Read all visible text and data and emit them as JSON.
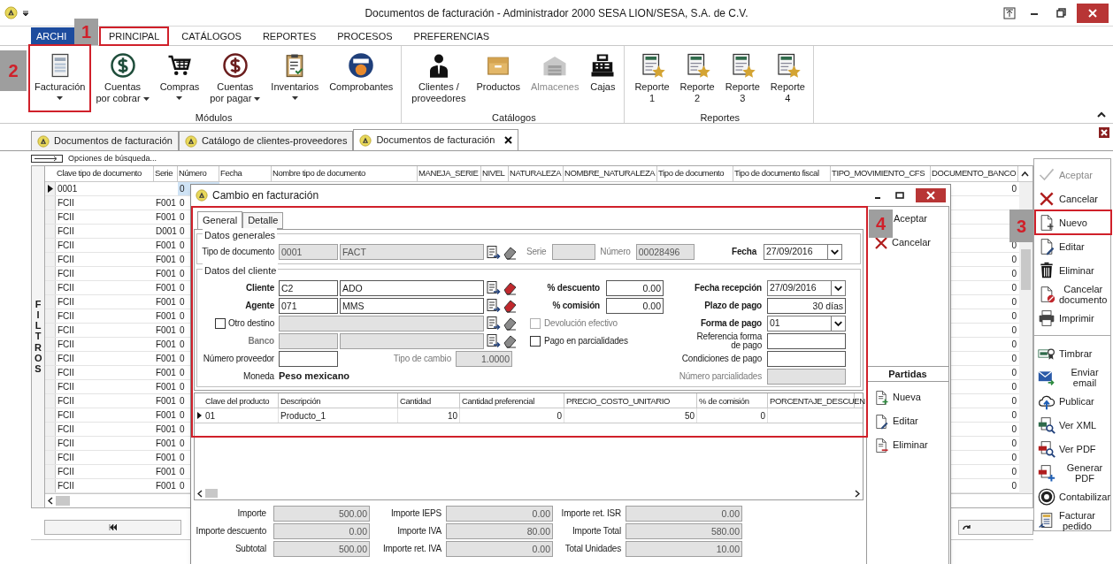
{
  "window": {
    "title": "Documentos de facturación - Administrador 2000 SESA LION/SESA, S.A. de C.V."
  },
  "menu_tabs": [
    {
      "label": "ARCHI",
      "kind": "file",
      "selected": false
    },
    {
      "label": "PRINCIPAL",
      "kind": "tab",
      "selected": true,
      "callout": "1"
    },
    {
      "label": "CATÁLOGOS",
      "kind": "tab",
      "selected": false
    },
    {
      "label": "REPORTES",
      "kind": "tab",
      "selected": false
    },
    {
      "label": "PROCESOS",
      "kind": "tab",
      "selected": false
    },
    {
      "label": "PREFERENCIAS",
      "kind": "tab",
      "selected": false
    }
  ],
  "ribbon_groups": [
    {
      "label": "Módulos",
      "buttons": [
        {
          "label": "Facturación",
          "kind": "invoice",
          "dropdown": true,
          "disabled": false,
          "callout": "2"
        },
        {
          "label": "Cuentas\npor cobrar",
          "kind": "dollar_green",
          "dropdown": true,
          "disabled": false
        },
        {
          "label": "Compras",
          "kind": "cart",
          "dropdown": true,
          "disabled": false
        },
        {
          "label": "Cuentas\npor pagar",
          "kind": "dollar_red",
          "dropdown": true,
          "disabled": false
        },
        {
          "label": "Inventarios",
          "kind": "clipboard",
          "dropdown": true,
          "disabled": false
        },
        {
          "label": "Comprobantes",
          "kind": "cfdi",
          "dropdown": false,
          "disabled": false
        }
      ]
    },
    {
      "label": "Catálogos",
      "buttons": [
        {
          "label": "Clientes /\nproveedores",
          "kind": "person",
          "dropdown": false,
          "disabled": false
        },
        {
          "label": "Productos",
          "kind": "box",
          "dropdown": false,
          "disabled": false
        },
        {
          "label": "Almacenes",
          "kind": "warehouse",
          "dropdown": false,
          "disabled": true
        },
        {
          "label": "Cajas",
          "kind": "register",
          "dropdown": false,
          "disabled": false
        }
      ]
    },
    {
      "label": "Reportes",
      "buttons": [
        {
          "label": "Reporte\n1",
          "kind": "report",
          "dropdown": false,
          "disabled": false
        },
        {
          "label": "Reporte\n2",
          "kind": "report",
          "dropdown": false,
          "disabled": false
        },
        {
          "label": "Reporte\n3",
          "kind": "report",
          "dropdown": false,
          "disabled": false
        },
        {
          "label": "Reporte\n4",
          "kind": "report",
          "dropdown": false,
          "disabled": false
        }
      ]
    }
  ],
  "doc_tabs": [
    {
      "label": "Documentos de facturación",
      "selected": false
    },
    {
      "label": "Catálogo de clientes-proveedores",
      "selected": false
    },
    {
      "label": "Documentos de facturación",
      "selected": true
    }
  ],
  "search_options": {
    "label": "Opciones de búsqueda..."
  },
  "filter_panel": {
    "label": "FILTROS"
  },
  "grid": {
    "columns": [
      "Clave tipo de documento",
      "Serie",
      "Número",
      "Fecha",
      "Nombre tipo de documento",
      "MANEJA_SERIE",
      "NIVEL",
      "NATURALEZA",
      "NOMBRE_NATURALEZA",
      "Tipo de documento",
      "Tipo de documento fiscal",
      "TIPO_MOVIMIENTO_CFS",
      "DOCUMENTO_BANCO"
    ],
    "rows": [
      {
        "clave": "0001",
        "numero": "0",
        "banco": "0",
        "selected": true
      },
      {
        "clave": "FCII",
        "serie": "F001",
        "numero": "0",
        "selected": false
      },
      {
        "clave": "FCII",
        "serie": "F001",
        "numero": "0",
        "selected": false
      },
      {
        "clave": "FCII",
        "serie": "D001",
        "numero": "0",
        "selected": false
      },
      {
        "clave": "FCII",
        "serie": "F001",
        "numero": "0",
        "banco": "0",
        "selected": false
      },
      {
        "clave": "FCII",
        "serie": "F001",
        "numero": "0",
        "banco": "0",
        "selected": false
      },
      {
        "clave": "FCII",
        "serie": "F001",
        "numero": "0",
        "banco": "0",
        "selected": false
      },
      {
        "clave": "FCII",
        "serie": "F001",
        "numero": "0",
        "banco": "0",
        "selected": false
      },
      {
        "clave": "FCII",
        "serie": "F001",
        "numero": "0",
        "banco": "0",
        "selected": false
      },
      {
        "clave": "FCII",
        "serie": "F001",
        "numero": "0",
        "banco": "0",
        "selected": false
      },
      {
        "clave": "FCII",
        "serie": "F001",
        "numero": "0",
        "banco": "0",
        "selected": false
      },
      {
        "clave": "FCII",
        "serie": "F001",
        "numero": "0",
        "banco": "0",
        "selected": false
      },
      {
        "clave": "FCII",
        "serie": "F001",
        "numero": "0",
        "banco": "0",
        "selected": false
      },
      {
        "clave": "FCII",
        "serie": "F001",
        "numero": "0",
        "banco": "0",
        "selected": false
      },
      {
        "clave": "FCII",
        "serie": "F001",
        "numero": "0",
        "banco": "0",
        "selected": false
      },
      {
        "clave": "FCII",
        "serie": "F001",
        "numero": "0",
        "banco": "0",
        "selected": false
      },
      {
        "clave": "FCII",
        "serie": "F001",
        "numero": "0",
        "banco": "0",
        "selected": false
      },
      {
        "clave": "FCII",
        "serie": "F001",
        "numero": "0",
        "banco": "0",
        "selected": false
      },
      {
        "clave": "FCII",
        "serie": "F001",
        "numero": "0",
        "banco": "0",
        "selected": false
      },
      {
        "clave": "FCII",
        "serie": "F001",
        "numero": "0",
        "banco": "0",
        "selected": false
      },
      {
        "clave": "FCII",
        "serie": "F001",
        "numero": "0",
        "banco": "0",
        "selected": false
      },
      {
        "clave": "FCII",
        "serie": "F001",
        "numero": "0",
        "banco": "0",
        "selected": false
      }
    ]
  },
  "actions": [
    [
      {
        "label": "Aceptar",
        "kind": "check",
        "disabled": true
      },
      {
        "label": "Cancelar",
        "kind": "xred",
        "disabled": false
      },
      {
        "label": "Nuevo",
        "kind": "newdoc",
        "disabled": false,
        "callout": "3"
      },
      {
        "label": "Editar",
        "kind": "editdoc",
        "disabled": false
      },
      {
        "label": "Eliminar",
        "kind": "trash",
        "disabled": false
      },
      {
        "label": "Cancelar\ndocumento",
        "kind": "canceldoc",
        "disabled": false
      },
      {
        "label": "Imprimir",
        "kind": "printer",
        "disabled": false
      }
    ],
    [
      {
        "label": "Timbrar",
        "kind": "stamp",
        "disabled": false
      },
      {
        "label": "Enviar email",
        "kind": "mail",
        "disabled": false
      },
      {
        "label": "Publicar",
        "kind": "cloud",
        "disabled": false
      },
      {
        "label": "Ver XML",
        "kind": "viewxml",
        "disabled": false
      },
      {
        "label": "Ver PDF",
        "kind": "viewpdf",
        "disabled": false
      },
      {
        "label": "Generar PDF",
        "kind": "genpdf",
        "disabled": false
      },
      {
        "label": "Contabilizar",
        "kind": "cf",
        "disabled": false
      },
      {
        "label": "Facturar\npedido",
        "kind": "order",
        "disabled": false
      }
    ]
  ],
  "dialog": {
    "title": "Cambio en facturación",
    "callout": "4",
    "tabs": [
      {
        "label": "General",
        "selected": true
      },
      {
        "label": "Detalle",
        "selected": false
      }
    ],
    "general": {
      "legend": "Datos generales",
      "tipo_documento": {
        "label": "Tipo de documento",
        "code": "0001",
        "name": "FACT",
        "disabled": true
      },
      "serie": {
        "label": "Serie",
        "disabled": true
      },
      "numero": {
        "label": "Número",
        "value": "00028496",
        "disabled": true
      },
      "fecha": {
        "label": "Fecha",
        "value": "27/09/2016"
      }
    },
    "client": {
      "legend": "Datos del cliente",
      "left": [
        {
          "kind": "lookup",
          "label": "Cliente",
          "code": "C2",
          "name": "ADO",
          "disabled": false
        },
        {
          "kind": "lookup",
          "label": "Agente",
          "code": "071",
          "name": "MMS",
          "disabled": false
        },
        {
          "kind": "check_lookup",
          "label": "Otro destino",
          "checked": false,
          "disabled": true
        },
        {
          "kind": "lookup",
          "label": "Banco",
          "disabled": true
        },
        {
          "kind": "text_pair",
          "label": "Número proveedor",
          "disabled": false,
          "pair": {
            "label": "Tipo de cambio",
            "value": "1.0000",
            "disabled": true
          }
        },
        {
          "kind": "static",
          "label": "Moneda",
          "value": "Peso mexicano"
        }
      ],
      "middle": [
        {
          "kind": "number",
          "label": "% descuento",
          "value": "0.00",
          "disabled": false
        },
        {
          "kind": "number",
          "label": "% comisión",
          "value": "0.00",
          "disabled": false
        },
        {
          "kind": "checkbox",
          "label": "Devolución efectivo",
          "checked": false,
          "disabled": true
        },
        {
          "kind": "checkbox",
          "label": "Pago en parcialidades",
          "checked": false,
          "disabled": false
        }
      ],
      "right": [
        {
          "kind": "date",
          "label": "Fecha recepción",
          "value": "27/09/2016"
        },
        {
          "kind": "number",
          "label": "Plazo de pago",
          "value": "30 días",
          "disabled": false
        },
        {
          "kind": "combo",
          "label": "Forma de pago",
          "value": "01"
        },
        {
          "kind": "text",
          "label": "Referencia forma\nde pago",
          "disabled": false
        },
        {
          "kind": "text",
          "label": "Condiciones de pago",
          "disabled": false
        },
        {
          "kind": "text",
          "label": "Número parcialidades",
          "disabled": true
        }
      ]
    },
    "items": {
      "columns": [
        "Clave del producto",
        "Descripción",
        "Cantidad",
        "Cantidad preferencial",
        "PRECIO_COSTO_UNITARIO",
        "% de comisión",
        "PORCENTAJE_DESCUEN"
      ],
      "rows": [
        {
          "cells": [
            "01",
            "Producto_1",
            "10",
            "0",
            "50",
            "0"
          ],
          "selected": true
        }
      ]
    },
    "totals": [
      [
        {
          "label": "Importe",
          "value": "500.00"
        },
        {
          "label": "Importe descuento",
          "value": "0.00"
        },
        {
          "label": "Subtotal",
          "value": "500.00"
        }
      ],
      [
        {
          "label": "Importe IEPS",
          "value": "0.00"
        },
        {
          "label": "Importe IVA",
          "value": "80.00"
        },
        {
          "label": "Importe ret. IVA",
          "value": "0.00"
        }
      ],
      [
        {
          "label": "Importe ret. ISR",
          "value": "0.00"
        },
        {
          "label": "Importe Total",
          "value": "580.00"
        },
        {
          "label": "Total Unidades",
          "value": "10.00"
        }
      ]
    ],
    "actions": [
      {
        "label": "Aceptar"
      },
      {
        "label": "Cancelar",
        "kind": "xred"
      }
    ],
    "partidas": {
      "title": "Partidas",
      "actions": [
        {
          "label": "Nueva",
          "kind": "newitem"
        },
        {
          "label": "Editar",
          "kind": "editdoc"
        },
        {
          "label": "Eliminar",
          "kind": "delitem"
        }
      ]
    }
  }
}
